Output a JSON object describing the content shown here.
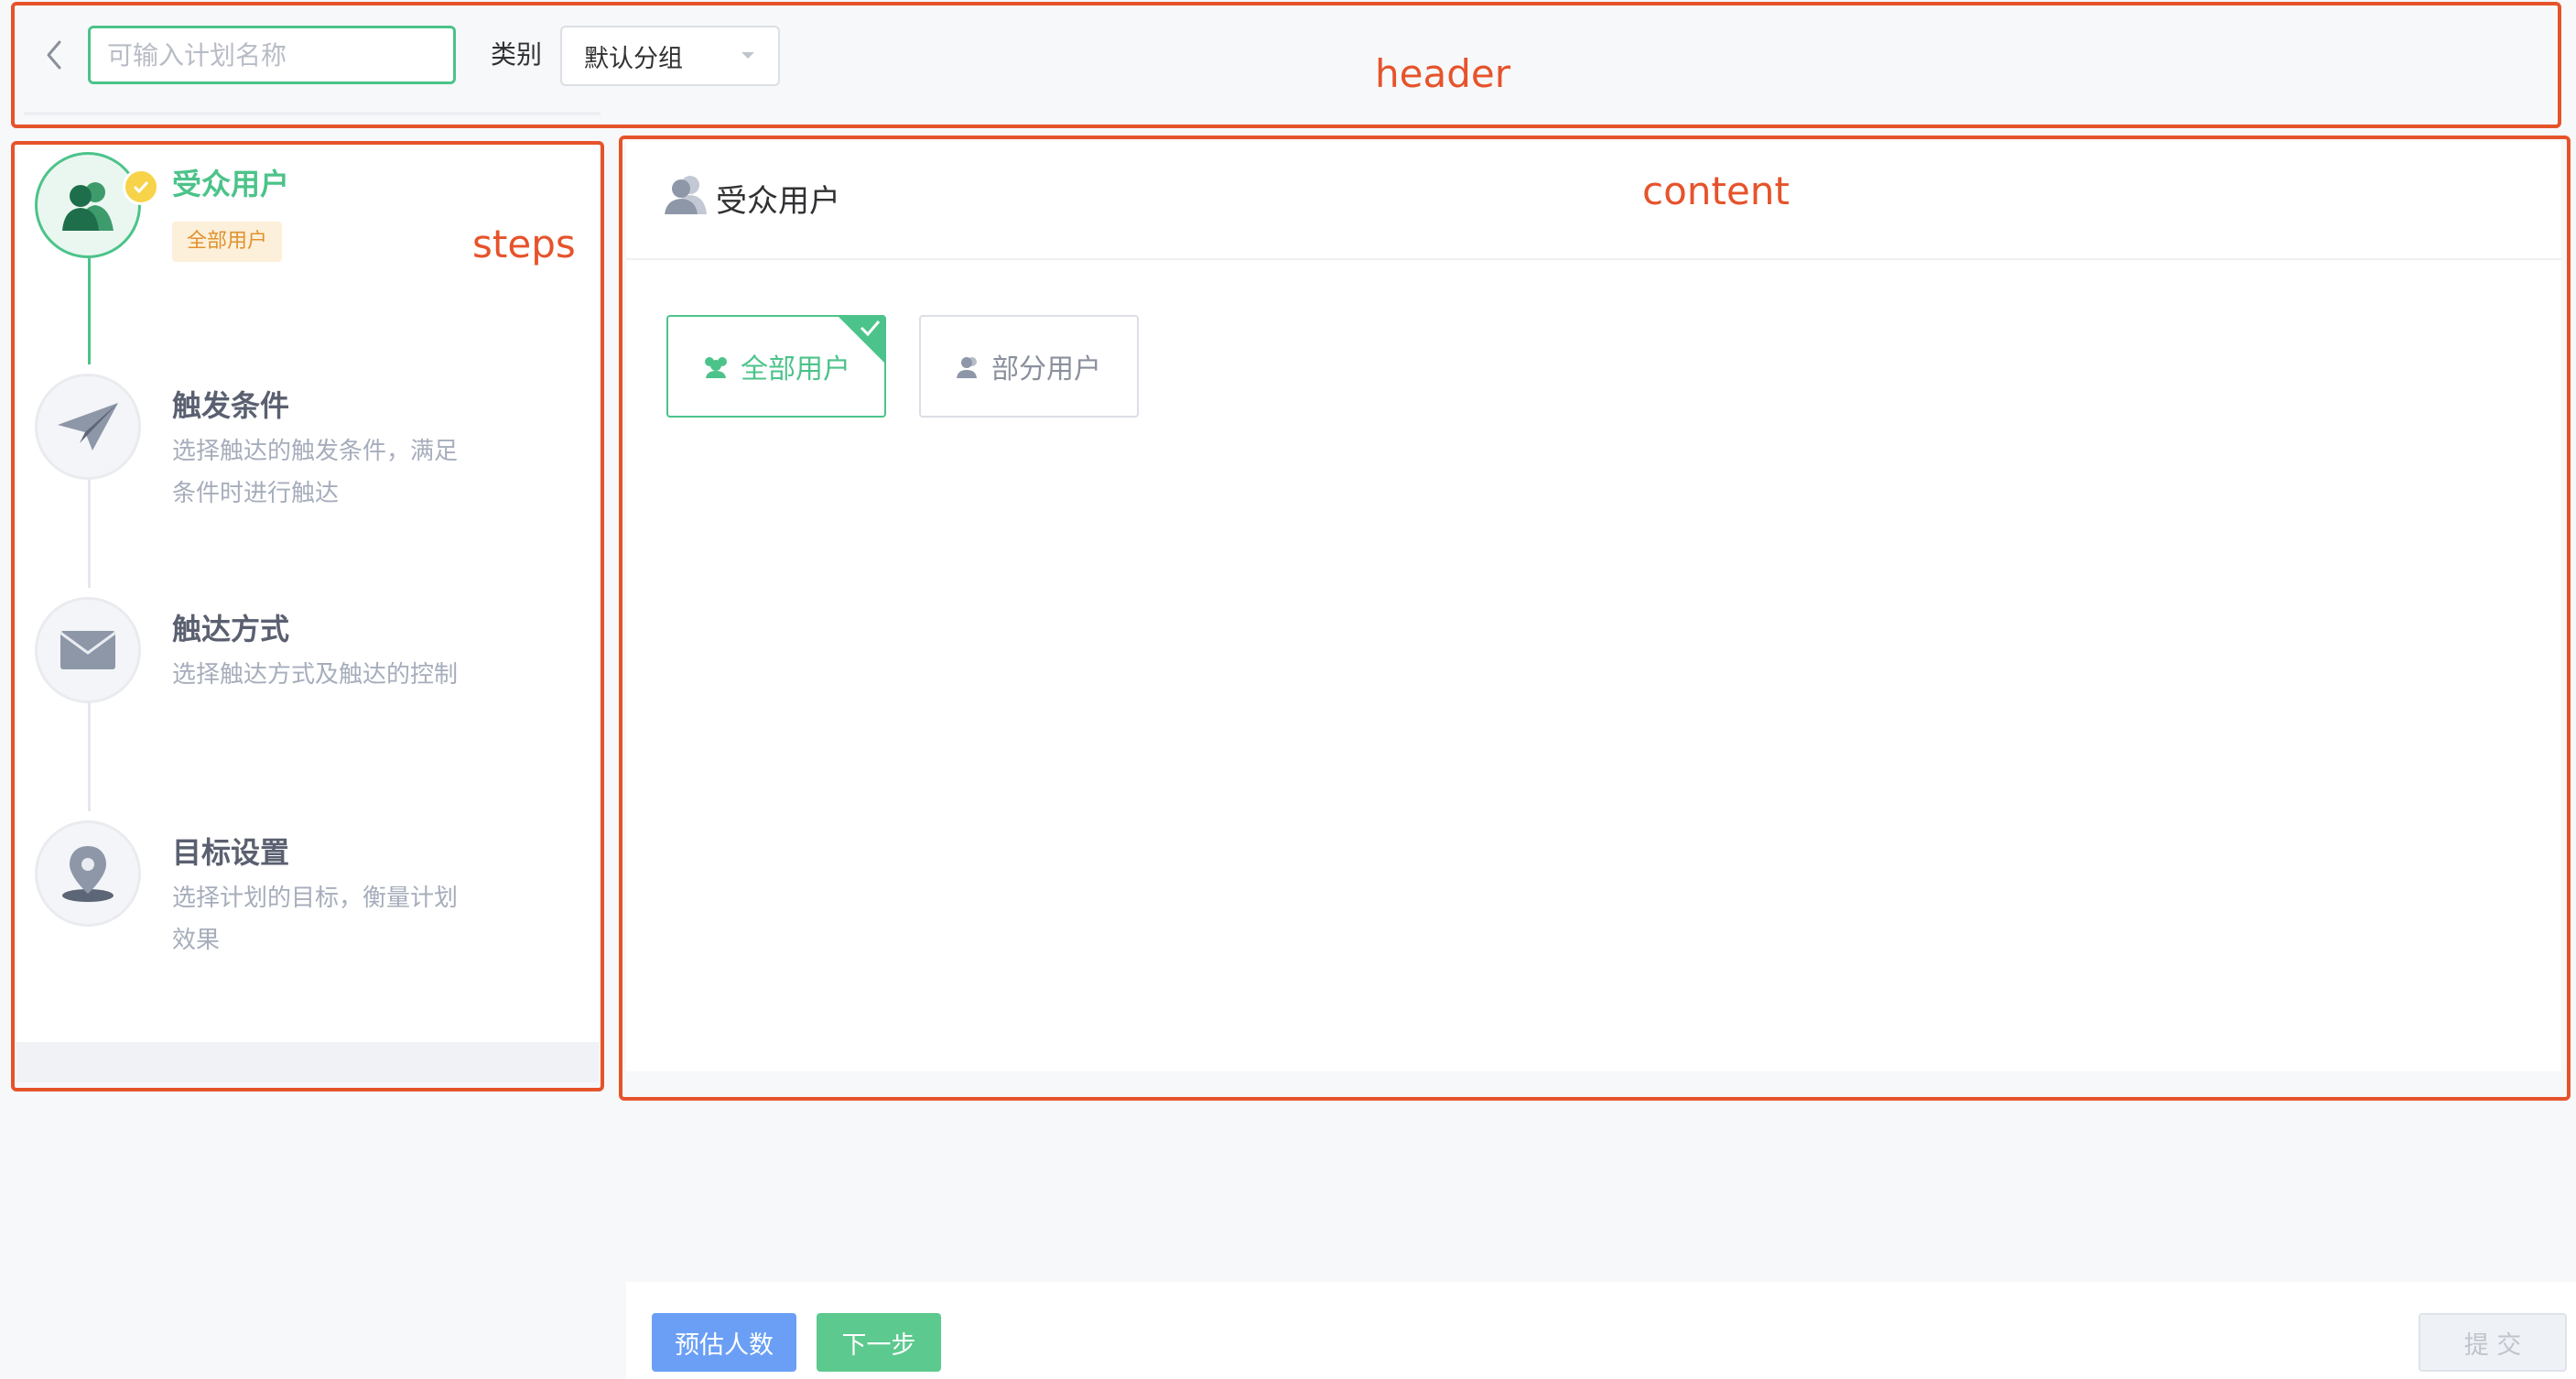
{
  "header": {
    "name_placeholder": "可输入计划名称",
    "category_label": "类别",
    "category_value": "默认分组"
  },
  "steps": [
    {
      "title": "受众用户",
      "tag": "全部用户",
      "active": true,
      "icon": "users-icon"
    },
    {
      "title": "触发条件",
      "description": "选择触达的触发条件，满足条件时进行触达",
      "icon": "paper-plane-icon"
    },
    {
      "title": "触达方式",
      "description": "选择触达方式及触达的控制",
      "icon": "envelope-icon"
    },
    {
      "title": "目标设置",
      "description": "选择计划的目标，衡量计划效果",
      "icon": "location-pin-icon"
    }
  ],
  "content": {
    "title": "受众用户",
    "options": [
      {
        "label": "全部用户",
        "selected": true,
        "icon": "users-icon"
      },
      {
        "label": "部分用户",
        "selected": false,
        "icon": "user-icon"
      }
    ]
  },
  "footer": {
    "estimate_label": "预估人数",
    "next_label": "下一步",
    "submit_label": "提 交"
  },
  "annotations": {
    "header": "header",
    "steps": "steps",
    "content": "content"
  },
  "colors": {
    "accent": "#4cc38a",
    "primary_blue": "#6a9ff5",
    "annotation": "#e6532b",
    "tag_bg": "#fdf0da",
    "tag_text": "#e0922e"
  }
}
